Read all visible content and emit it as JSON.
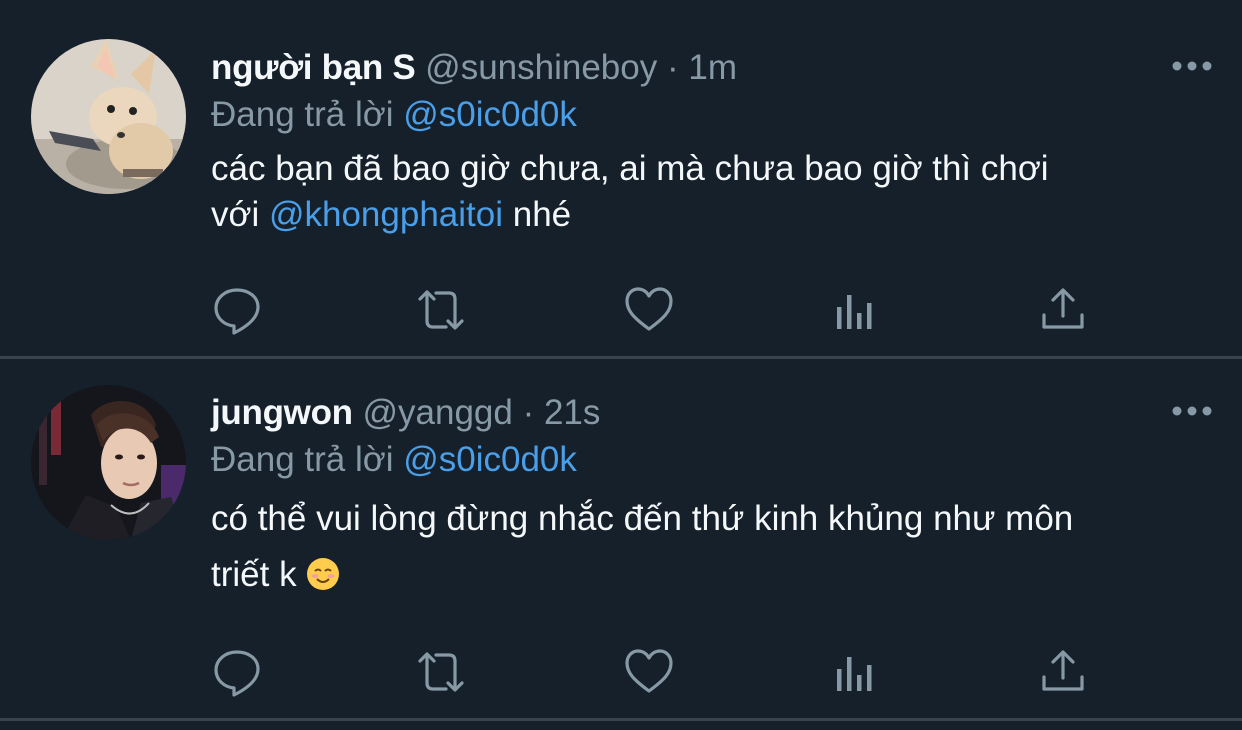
{
  "colors": {
    "background": "#15202b",
    "mention": "#4a9fe8",
    "muted": "#8899a6",
    "divider": "#38444d"
  },
  "tweets": [
    {
      "avatar_icon": "fennec-fox-avatar",
      "name": "người bạn S",
      "handle": "@sunshineboy",
      "dot": "·",
      "time": "1m",
      "reply_prefix": "Đang trả lời",
      "reply_to": "@s0ic0d0k",
      "text_line1": "các bạn đã bao giờ chưa, ai mà chưa bao giờ thì chơi",
      "text_line2_pre": "với",
      "text_mention": "@khongphaitoi",
      "text_line2_post": "nhé"
    },
    {
      "avatar_icon": "person-portrait-avatar",
      "name": "jungwon",
      "handle": "@yanggd",
      "dot": "·",
      "time": "21s",
      "reply_prefix": "Đang trả lời",
      "reply_to": "@s0ic0d0k",
      "text_line1": "có thể vui lòng đừng nhắc đến thứ kinh khủng như môn",
      "text_line2": "triết k",
      "emoji": "smiling-face-emoji"
    }
  ],
  "actions": [
    "reply-icon",
    "retweet-icon",
    "like-icon",
    "analytics-icon",
    "share-icon"
  ]
}
